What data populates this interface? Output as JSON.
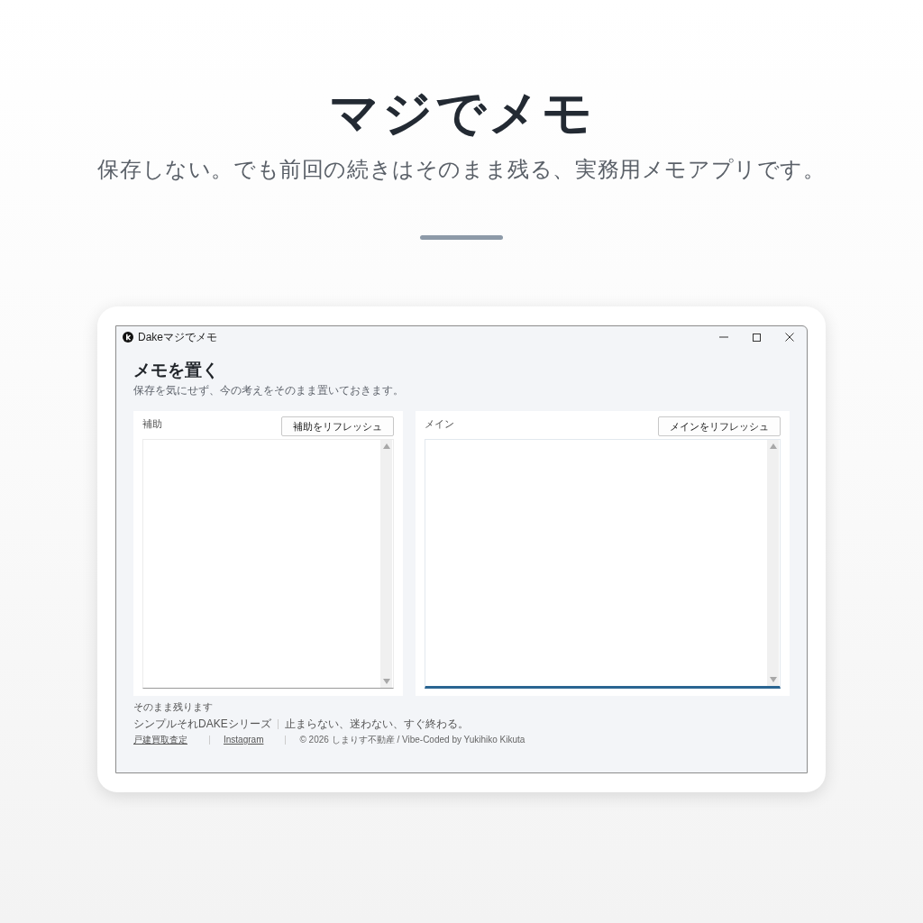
{
  "hero": {
    "title": "マジでメモ",
    "subtitle": "保存しない。でも前回の続きはそのまま残る、実務用メモアプリです。"
  },
  "window": {
    "title": "Dakeマジでメモ"
  },
  "app": {
    "heading": "メモを置く",
    "description": "保存を気にせず、今の考えをそのまま置いておきます。",
    "panes": [
      {
        "label": "補助",
        "button": "補助をリフレッシュ",
        "focused": false
      },
      {
        "label": "メイン",
        "button": "メインをリフレッシュ",
        "focused": true
      }
    ],
    "status": "そのまま残ります"
  },
  "footer": {
    "series": [
      "シンプルそれDAKEシリーズ",
      "止まらない、迷わない、すぐ終わる。"
    ],
    "links": [
      {
        "kind": "link",
        "text": "戸建買取査定"
      },
      {
        "kind": "link",
        "text": "Instagram"
      },
      {
        "kind": "text",
        "text": "© 2026 しまりす不動産 / Vibe-Coded by Yukihiko Kikuta"
      }
    ]
  }
}
